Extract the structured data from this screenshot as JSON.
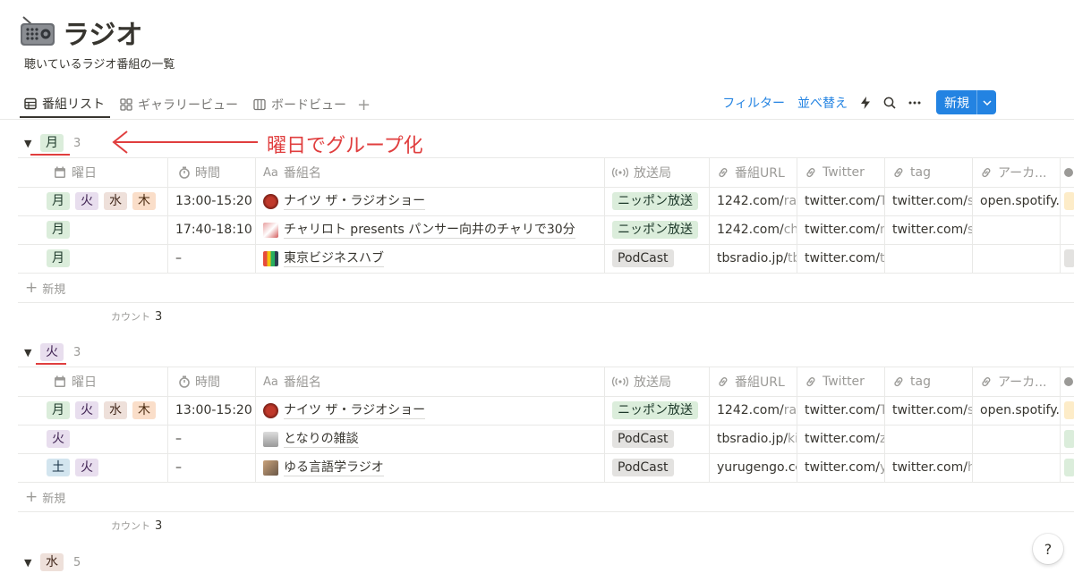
{
  "page": {
    "title": "ラジオ",
    "description": "聴いているラジオ番組の一覧"
  },
  "tabs": [
    {
      "label": "番組リスト",
      "icon": "table-icon"
    },
    {
      "label": "ギャラリービュー",
      "icon": "gallery-icon"
    },
    {
      "label": "ボードビュー",
      "icon": "board-icon"
    }
  ],
  "toolbar": {
    "filter_label": "フィルター",
    "sort_label": "並べ替え",
    "new_label": "新規"
  },
  "annotation": {
    "text": "曜日でグループ化"
  },
  "columns": {
    "day": "曜日",
    "time": "時間",
    "name_prefix": "Aa",
    "name": "番組名",
    "station": "放送局",
    "url": "番組URL",
    "twitter": "Twitter",
    "tag": "tag",
    "archive": "アーカ..."
  },
  "groups": [
    {
      "label": "月",
      "count": "3",
      "new_label": "新規",
      "footer_label": "カウント",
      "footer_value": "3",
      "rows": [
        {
          "days": [
            "月",
            "火",
            "水",
            "木"
          ],
          "time": "13:00-15:20",
          "name": "ナイツ ザ・ラジオショー",
          "station": "ニッポン放送",
          "url_main": "1242.com/",
          "url_rest": "radio",
          "tw_main": "twitter.com/",
          "tw_rest": "Th",
          "tag_main": "twitter.com/",
          "tag_rest": "sea",
          "archive": "open.spotify.co"
        },
        {
          "days": [
            "月"
          ],
          "time": "17:40-18:10",
          "name": "チャリロト presents パンサー向井のチャリで30分",
          "station": "ニッポン放送",
          "url_main": "1242.com/",
          "url_rest": "char",
          "tw_main": "twitter.com/",
          "tw_rest": "mu",
          "tag_main": "twitter.com/",
          "tag_rest": "sea",
          "archive": ""
        },
        {
          "days": [
            "月"
          ],
          "time": "–",
          "name": "東京ビジネスハブ",
          "station": "PodCast",
          "url_main": "tbsradio.jp/",
          "url_rest": "tbh",
          "tw_main": "twitter.com/",
          "tw_rest": "tok",
          "tag_main": "",
          "tag_rest": "",
          "archive": ""
        }
      ]
    },
    {
      "label": "火",
      "count": "3",
      "new_label": "新規",
      "footer_label": "カウント",
      "footer_value": "3",
      "rows": [
        {
          "days": [
            "月",
            "火",
            "水",
            "木"
          ],
          "time": "13:00-15:20",
          "name": "ナイツ ザ・ラジオショー",
          "station": "ニッポン放送",
          "url_main": "1242.com/",
          "url_rest": "radio",
          "tw_main": "twitter.com/",
          "tw_rest": "Th",
          "tag_main": "twitter.com/",
          "tag_rest": "sea",
          "archive": "open.spotify.co"
        },
        {
          "days": [
            "火"
          ],
          "time": "–",
          "name": "となりの雑談",
          "station": "PodCast",
          "url_main": "tbsradio.jp/",
          "url_rest": "kiki",
          "tw_main": "twitter.com/",
          "tw_rest": "zat",
          "tag_main": "",
          "tag_rest": "",
          "archive": ""
        },
        {
          "days": [
            "土",
            "火"
          ],
          "time": "–",
          "name": "ゆる言語学ラジオ",
          "station": "PodCast",
          "url_main": "yurugengo.con",
          "url_rest": "",
          "tw_main": "twitter.com/",
          "tw_rest": "yu",
          "tag_main": "twitter.com/",
          "tag_rest": "ha",
          "archive": ""
        }
      ]
    },
    {
      "label": "水",
      "count": "5"
    }
  ],
  "help": "?",
  "colors": {
    "accent": "#2383e2",
    "annotation": "#e03e3e",
    "text": "#37352f",
    "muted": "#9b9a97"
  }
}
